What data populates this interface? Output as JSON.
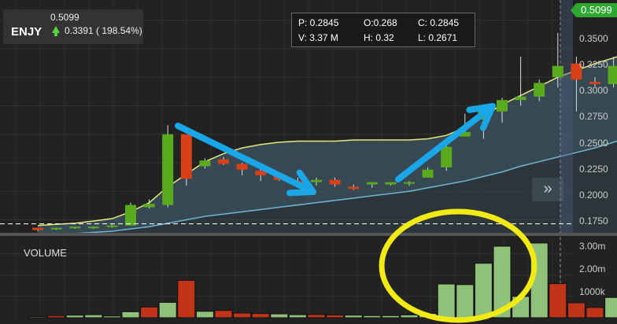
{
  "ticker": {
    "symbol": "ENJY",
    "price": "0.5099",
    "change": "0.3391 ( 198.54%)",
    "change_direction": "up",
    "up_color": "#5bd33f"
  },
  "ohlc": {
    "p_label": "P: 0.2845",
    "o_label": "O:0.268",
    "c_label": "C: 0.2845",
    "v_label": "V: 3.37 M",
    "h_label": "H: 0.32",
    "l_label": "L: 0.2671"
  },
  "current_price_tag": "0.5099",
  "volume_label": "VOLUME",
  "nav_button": "»",
  "colors": {
    "background": "#222222",
    "bull": "#5aaa1e",
    "bear": "#d8401a",
    "vol_bull": "#8fc17a",
    "vol_bear": "#c0341a",
    "band_fill": "#3d5563",
    "ma_upper": "#e8e87a",
    "ma_lower": "#6fb6d8",
    "annotation_arrow": "#1aa7e8",
    "annotation_circle": "#f2ea14",
    "price_tag": "#2fa832"
  },
  "chart_data": [
    {
      "type": "candlestick",
      "title": "",
      "y_axis": {
        "ticks": [
          "0.3500",
          "0.3250",
          "0.3000",
          "0.2750",
          "0.2500",
          "0.2250",
          "0.2000",
          "0.1750"
        ],
        "range": [
          0.165,
          0.365
        ]
      },
      "candles": [
        {
          "o": 0.168,
          "h": 0.168,
          "l": 0.165,
          "c": 0.166
        },
        {
          "o": 0.167,
          "h": 0.168,
          "l": 0.166,
          "c": 0.168
        },
        {
          "o": 0.168,
          "h": 0.169,
          "l": 0.167,
          "c": 0.169
        },
        {
          "o": 0.168,
          "h": 0.169,
          "l": 0.167,
          "c": 0.169
        },
        {
          "o": 0.169,
          "h": 0.171,
          "l": 0.168,
          "c": 0.17
        },
        {
          "o": 0.17,
          "h": 0.19,
          "l": 0.17,
          "c": 0.188
        },
        {
          "o": 0.186,
          "h": 0.193,
          "l": 0.185,
          "c": 0.189
        },
        {
          "o": 0.188,
          "h": 0.258,
          "l": 0.186,
          "c": 0.25
        },
        {
          "o": 0.25,
          "h": 0.25,
          "l": 0.205,
          "c": 0.211
        },
        {
          "o": 0.222,
          "h": 0.229,
          "l": 0.22,
          "c": 0.227
        },
        {
          "o": 0.228,
          "h": 0.23,
          "l": 0.223,
          "c": 0.224
        },
        {
          "o": 0.224,
          "h": 0.225,
          "l": 0.214,
          "c": 0.219
        },
        {
          "o": 0.218,
          "h": 0.22,
          "l": 0.209,
          "c": 0.214
        },
        {
          "o": 0.214,
          "h": 0.216,
          "l": 0.209,
          "c": 0.21
        },
        {
          "o": 0.209,
          "h": 0.212,
          "l": 0.203,
          "c": 0.206
        },
        {
          "o": 0.208,
          "h": 0.212,
          "l": 0.205,
          "c": 0.21
        },
        {
          "o": 0.21,
          "h": 0.212,
          "l": 0.204,
          "c": 0.206
        },
        {
          "o": 0.204,
          "h": 0.206,
          "l": 0.201,
          "c": 0.202
        },
        {
          "o": 0.206,
          "h": 0.207,
          "l": 0.203,
          "c": 0.208
        },
        {
          "o": 0.206,
          "h": 0.208,
          "l": 0.205,
          "c": 0.208
        },
        {
          "o": 0.207,
          "h": 0.209,
          "l": 0.205,
          "c": 0.208
        },
        {
          "o": 0.212,
          "h": 0.221,
          "l": 0.212,
          "c": 0.219
        },
        {
          "o": 0.221,
          "h": 0.242,
          "l": 0.218,
          "c": 0.239
        },
        {
          "o": 0.248,
          "h": 0.268,
          "l": 0.248,
          "c": 0.252
        },
        {
          "o": 0.263,
          "h": 0.276,
          "l": 0.246,
          "c": 0.271
        },
        {
          "o": 0.27,
          "h": 0.282,
          "l": 0.26,
          "c": 0.28
        },
        {
          "o": 0.28,
          "h": 0.318,
          "l": 0.275,
          "c": 0.283
        },
        {
          "o": 0.283,
          "h": 0.298,
          "l": 0.279,
          "c": 0.295
        },
        {
          "o": 0.3,
          "h": 0.339,
          "l": 0.291,
          "c": 0.31
        },
        {
          "o": 0.312,
          "h": 0.318,
          "l": 0.27,
          "c": 0.298
        },
        {
          "o": 0.296,
          "h": 0.3,
          "l": 0.292,
          "c": 0.294
        },
        {
          "o": 0.294,
          "h": 0.318,
          "l": 0.291,
          "c": 0.31
        },
        {
          "o": 0.31,
          "h": 0.316,
          "l": 0.288,
          "c": 0.297
        }
      ],
      "ma_upper": [
        0.17,
        0.171,
        0.172,
        0.174,
        0.176,
        0.182,
        0.19,
        0.204,
        0.215,
        0.226,
        0.233,
        0.238,
        0.241,
        0.243,
        0.244,
        0.244,
        0.244,
        0.245,
        0.245,
        0.245,
        0.245,
        0.246,
        0.249,
        0.256,
        0.266,
        0.276,
        0.284,
        0.292,
        0.3,
        0.306,
        0.312,
        0.317,
        0.322
      ],
      "ma_lower": [
        0.162,
        0.163,
        0.163,
        0.164,
        0.165,
        0.167,
        0.169,
        0.172,
        0.175,
        0.178,
        0.18,
        0.182,
        0.184,
        0.186,
        0.188,
        0.19,
        0.192,
        0.194,
        0.196,
        0.198,
        0.2,
        0.203,
        0.206,
        0.209,
        0.213,
        0.217,
        0.222,
        0.226,
        0.23,
        0.234,
        0.238,
        0.243,
        0.248
      ]
    },
    {
      "type": "bar",
      "title": "VOLUME",
      "y_axis": {
        "ticks": [
          "3.00m",
          "2.00m",
          "1000k"
        ],
        "range": [
          0,
          3.5
        ]
      },
      "bars": [
        {
          "v": 0.05,
          "dir": "up"
        },
        {
          "v": 0.1,
          "dir": "down"
        },
        {
          "v": 0.12,
          "dir": "up"
        },
        {
          "v": 0.14,
          "dir": "up"
        },
        {
          "v": 0.08,
          "dir": "up"
        },
        {
          "v": 0.28,
          "dir": "up"
        },
        {
          "v": 0.5,
          "dir": "down"
        },
        {
          "v": 0.72,
          "dir": "up"
        },
        {
          "v": 1.75,
          "dir": "down"
        },
        {
          "v": 0.3,
          "dir": "up"
        },
        {
          "v": 0.34,
          "dir": "down"
        },
        {
          "v": 0.22,
          "dir": "down"
        },
        {
          "v": 0.2,
          "dir": "down"
        },
        {
          "v": 0.18,
          "dir": "up"
        },
        {
          "v": 0.14,
          "dir": "up"
        },
        {
          "v": 0.15,
          "dir": "down"
        },
        {
          "v": 0.13,
          "dir": "down"
        },
        {
          "v": 0.12,
          "dir": "up"
        },
        {
          "v": 0.1,
          "dir": "up"
        },
        {
          "v": 0.1,
          "dir": "up"
        },
        {
          "v": 0.13,
          "dir": "up"
        },
        {
          "v": 0.2,
          "dir": "up"
        },
        {
          "v": 1.58,
          "dir": "up"
        },
        {
          "v": 1.55,
          "dir": "up"
        },
        {
          "v": 2.55,
          "dir": "up"
        },
        {
          "v": 3.35,
          "dir": "up"
        },
        {
          "v": 1.0,
          "dir": "up"
        },
        {
          "v": 3.5,
          "dir": "up"
        },
        {
          "v": 1.6,
          "dir": "down"
        },
        {
          "v": 0.7,
          "dir": "down"
        },
        {
          "v": 0.48,
          "dir": "down"
        },
        {
          "v": 0.95,
          "dir": "up"
        },
        {
          "v": 0.15,
          "dir": "down"
        }
      ]
    }
  ]
}
